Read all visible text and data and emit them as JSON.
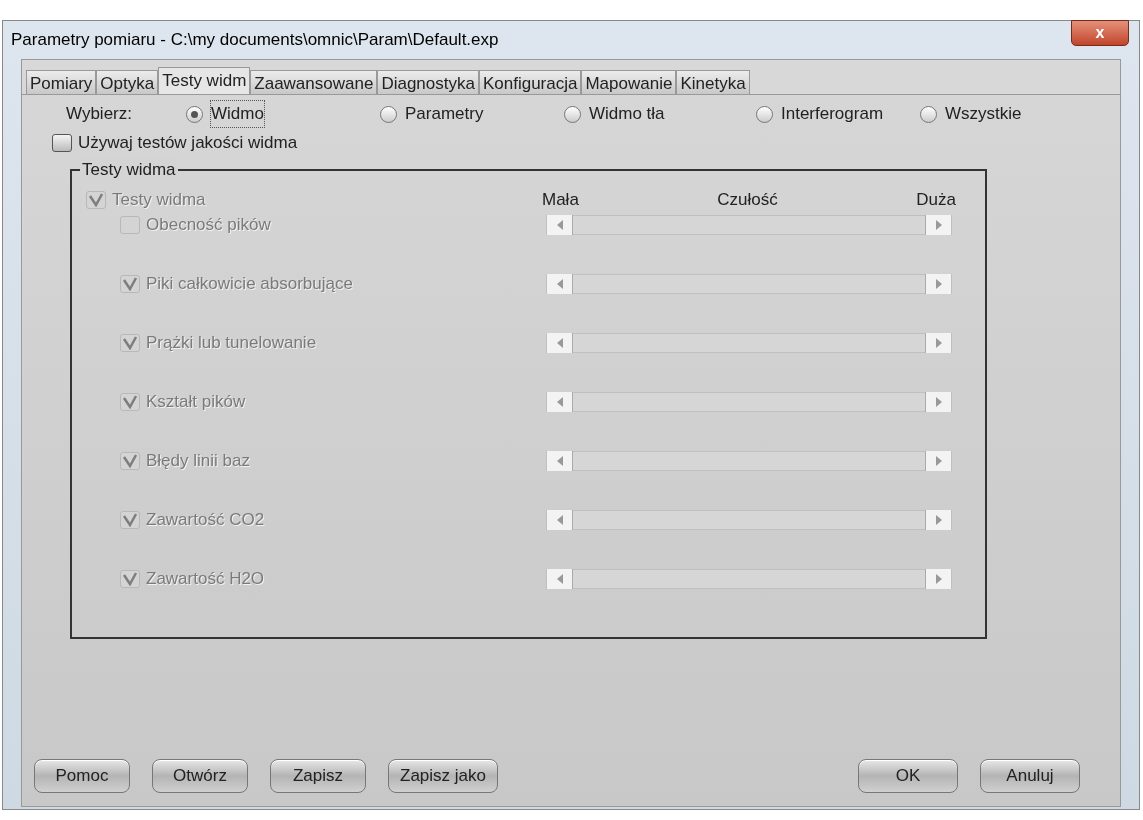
{
  "window": {
    "title": "Parametry pomiaru - C:\\my documents\\omnic\\Param\\Default.exp",
    "close": "x"
  },
  "tabs": [
    {
      "label": "Pomiary",
      "selected": false
    },
    {
      "label": "Optyka",
      "selected": false
    },
    {
      "label": "Testy widm",
      "selected": true
    },
    {
      "label": "Zaawansowane",
      "selected": false
    },
    {
      "label": "Diagnostyka",
      "selected": false
    },
    {
      "label": "Konfiguracja",
      "selected": false
    },
    {
      "label": "Mapowanie",
      "selected": false
    },
    {
      "label": "Kinetyka",
      "selected": false
    }
  ],
  "choose": {
    "label": "Wybierz:",
    "options": [
      {
        "label": "Widmo",
        "selected": true
      },
      {
        "label": "Parametry",
        "selected": false
      },
      {
        "label": "Widmo tła",
        "selected": false
      },
      {
        "label": "Interferogram",
        "selected": false
      },
      {
        "label": "Wszystkie",
        "selected": false
      }
    ]
  },
  "use_quality_tests": {
    "label": "Używaj testów jakości widma",
    "checked": false
  },
  "group": {
    "title": "Testy widma",
    "master": {
      "label": "Testy widma",
      "checked": true,
      "disabled": true
    },
    "scale": {
      "low": "Mała",
      "title": "Czułość",
      "high": "Duża"
    },
    "tests": [
      {
        "label": "Obecność pików",
        "checked": false,
        "disabled": true
      },
      {
        "label": "Piki całkowicie absorbujące",
        "checked": true,
        "disabled": true
      },
      {
        "label": "Prążki lub tunelowanie",
        "checked": true,
        "disabled": true
      },
      {
        "label": "Kształt pików",
        "checked": true,
        "disabled": true
      },
      {
        "label": "Błędy linii baz",
        "checked": true,
        "disabled": true
      },
      {
        "label": "Zawartość CO2",
        "checked": true,
        "disabled": true
      },
      {
        "label": "Zawartość H2O",
        "checked": true,
        "disabled": true
      }
    ]
  },
  "buttons_left": [
    "Pomoc",
    "Otwórz",
    "Zapisz",
    "Zapisz jako"
  ],
  "buttons_right": [
    "OK",
    "Anuluj"
  ]
}
